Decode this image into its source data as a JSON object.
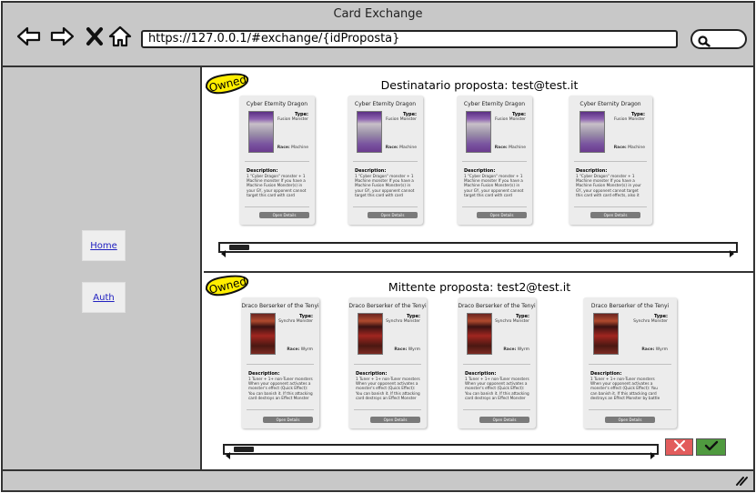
{
  "window": {
    "title": "Card Exchange"
  },
  "browser": {
    "url": "https://127.0.0.1/#exchange/{idProposta}",
    "search_value": ""
  },
  "sidebar": {
    "items": [
      {
        "label": "Home"
      },
      {
        "label": "Auth"
      }
    ]
  },
  "sections": [
    {
      "badge": "Owned",
      "title": "Destinatario proposta: test@test.it",
      "cards": [
        {
          "name": "Cyber Eternity Dragon",
          "type_label": "Type:",
          "type": "Fusion Monster",
          "race_label": "Race:",
          "race": "Machine",
          "desc_label": "Description:",
          "desc": "1 \"Cyber Dragon\" monster + 1 Machine monster\nIf you have a Machine Fusion Monster(s) in your GY, your opponent cannot target this card with card effects, also it cannot be",
          "button": "Open Details"
        },
        {
          "name": "Cyber Eternity Dragon",
          "type_label": "Type:",
          "type": "Fusion Monster",
          "race_label": "Race:",
          "race": "Machine",
          "desc_label": "Description:",
          "desc": "1 \"Cyber Dragon\" monster + 1 Machine monster\nIf you have a Machine Fusion Monster(s) in your GY, your opponent cannot target this card with card effects, also it cannot be",
          "button": "Open Details"
        },
        {
          "name": "Cyber Eternity Dragon",
          "type_label": "Type:",
          "type": "Fusion Monster",
          "race_label": "Race:",
          "race": "Machine",
          "desc_label": "Description:",
          "desc": "1 \"Cyber Dragon\" monster + 1 Machine monster\nIf you have a Machine Fusion Monster(s) in your GY, your opponent cannot target this card with card effects, also it cannot be",
          "button": "Open Details"
        },
        {
          "name": "Cyber Eternity Dragon",
          "type_label": "Type:",
          "type": "Fusion Monster",
          "race_label": "Race:",
          "race": "Machine",
          "desc_label": "Description:",
          "desc": "1 \"Cyber Dragon\" monster + 1 Machine monster\nIf you have a Machine Fusion Monster(s) in your GY, your opponent cannot target this card with card effects, also it cannot be",
          "button": "Open Details"
        }
      ]
    },
    {
      "badge": "Owned",
      "title": "Mittente proposta: test2@test.it",
      "cards": [
        {
          "name": "Draco Berserker of the Tenyi",
          "type_label": "Type:",
          "type": "Synchro Monster",
          "race_label": "Race:",
          "race": "Wyrm",
          "desc_label": "Description:",
          "desc": "1 Tuner + 1+ non-Tuner monsters\nWhen your opponent activates a monster's effect (Quick Effect): You can banish it. If this attacking card destroys an Effect Monster by battle and sends it to the GY: This card gains",
          "button": "Open Details"
        },
        {
          "name": "Draco Berserker of the Tenyi",
          "type_label": "Type:",
          "type": "Synchro Monster",
          "race_label": "Race:",
          "race": "Wyrm",
          "desc_label": "Description:",
          "desc": "1 Tuner + 1+ non-Tuner monsters\nWhen your opponent activates a monster's effect (Quick Effect): You can banish it. If this attacking card destroys an Effect Monster by battle and sends it to the GY: This card gains",
          "button": "Open Details"
        },
        {
          "name": "Draco Berserker of the Tenyi",
          "type_label": "Type:",
          "type": "Synchro Monster",
          "race_label": "Race:",
          "race": "Wyrm",
          "desc_label": "Description:",
          "desc": "1 Tuner + 1+ non-Tuner monsters\nWhen your opponent activates a monster's effect (Quick Effect): You can banish it. If this attacking card destroys an Effect Monster by battle and sends it to the GY: This card gains",
          "button": "Open Details"
        },
        {
          "name": "Draco Berserker of the Tenyi",
          "type_label": "Type:",
          "type": "Synchro Monster",
          "race_label": "Race:",
          "race": "Wyrm",
          "desc_label": "Description:",
          "desc": "1 Tuner + 1+ non-Tuner monsters\nWhen your opponent activates a monster's effect (Quick Effect): You can banish it. If this attacking card destroys an Effect Monster by battle and sends it to the GY: This card gains",
          "button": "Open Details"
        }
      ]
    }
  ],
  "colors": {
    "chrome": "#c8c8c8",
    "badge": "#ffee00",
    "reject": "#e25c5c",
    "accept": "#4f9a3f"
  },
  "icons": [
    "back-arrow-icon",
    "forward-arrow-icon",
    "close-icon",
    "home-icon",
    "search-icon",
    "reject-x-icon",
    "accept-check-icon",
    "resize-grip-icon"
  ]
}
